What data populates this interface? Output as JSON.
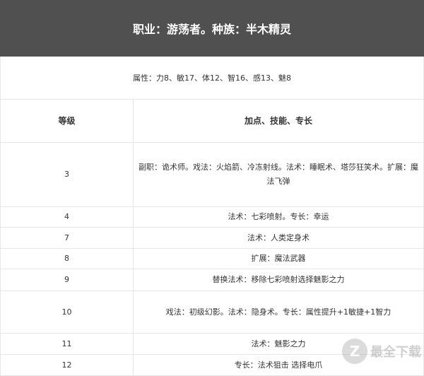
{
  "title": "职业：游荡者。种族：半木精灵",
  "attributes": "属性：力8、敏17、体12、智16、感13、魅8",
  "table": {
    "headers": [
      "等级",
      "加点、技能、专长"
    ],
    "rows": [
      {
        "level": "3",
        "content": "副职：诡术师。戏法：火焰箭、冷冻射线。法术：睡眠术、塔莎狂笑术。扩展：魔法飞弹"
      },
      {
        "level": "4",
        "content": "法术：七彩喷射。专长：幸运"
      },
      {
        "level": "7",
        "content": "法术：人类定身术"
      },
      {
        "level": "8",
        "content": "扩展：魔法武器"
      },
      {
        "level": "9",
        "content": "替换法术：移除七彩喷射选择魅影之力"
      },
      {
        "level": "10",
        "content": "戏法：初级幻影。法术：隐身术。专长：属性提升+1敏捷+1智力"
      },
      {
        "level": "11",
        "content": "法术：魅影之力"
      },
      {
        "level": "12",
        "content": "专长：法术狙击 选择电爪"
      }
    ]
  },
  "watermark": {
    "text": "最全下载",
    "icon": "z-logo-icon"
  }
}
